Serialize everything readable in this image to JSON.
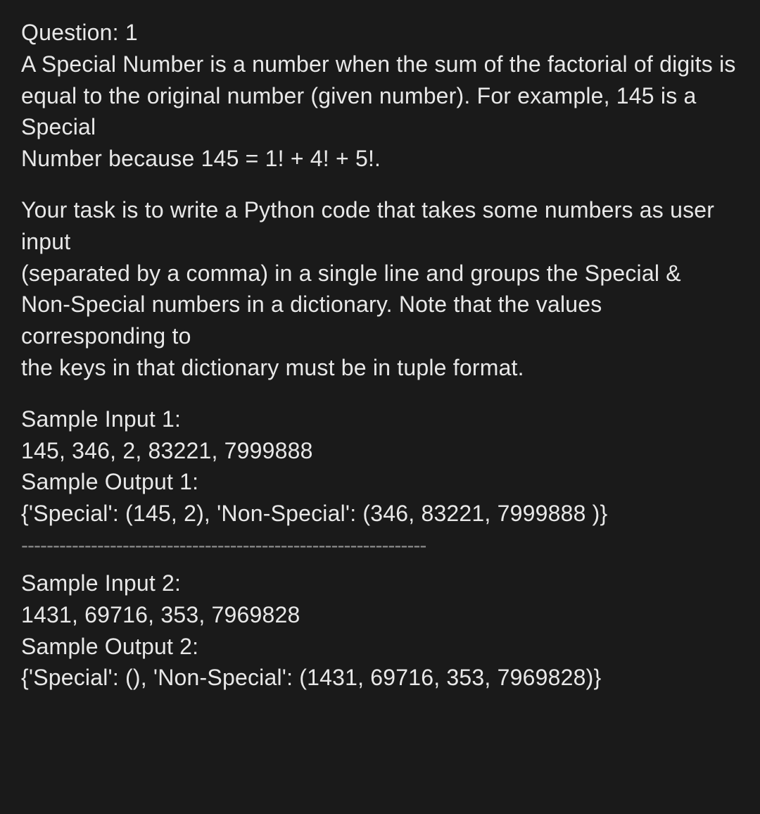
{
  "question": {
    "title": "Question: 1",
    "def_line1": "A Special Number is a number when the sum of the factorial of digits is",
    "def_line2": "equal to the original number (given number). For example, 145 is a Special",
    "def_line3": "Number because 145 = 1! + 4! + 5!.",
    "task_line1": "Your task is to write a Python code that takes some numbers as user input",
    "task_line2": "(separated by a comma) in a single line and groups the Special &",
    "task_line3": "Non-Special numbers in a dictionary. Note that the values corresponding to",
    "task_line4": "the keys in that dictionary must be in tuple format.",
    "sample1": {
      "input_label": "Sample Input 1:",
      "input_value": "145, 346, 2, 83221, 7999888",
      "output_label": "Sample Output 1:",
      "output_value": "{'Special': (145, 2), 'Non-Special': (346, 83221, 7999888 )}"
    },
    "divider": "----------------------------------------------------------------",
    "sample2": {
      "input_label": "Sample Input 2:",
      "input_value": "1431, 69716, 353, 7969828",
      "output_label": "Sample Output 2:",
      "output_value": "{'Special': (), 'Non-Special': (1431, 69716, 353, 7969828)}"
    }
  }
}
